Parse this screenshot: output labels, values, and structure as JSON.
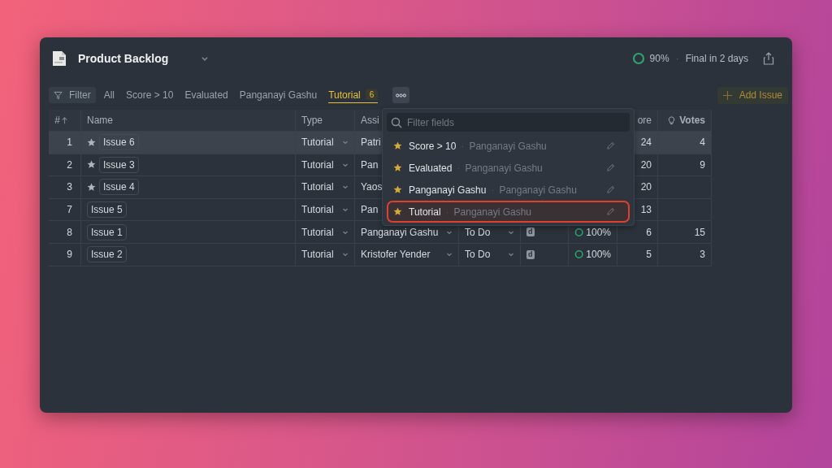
{
  "window": {
    "title": "Product Backlog",
    "progress": "90%",
    "separator": "·",
    "deadline": "Final in 2 days"
  },
  "toolbar": {
    "filter": "Filter",
    "tabs": [
      {
        "label": "All",
        "selected": false
      },
      {
        "label": "Score > 10",
        "selected": false
      },
      {
        "label": "Evaluated",
        "selected": false
      },
      {
        "label": "Panganayi Gashu",
        "selected": false
      },
      {
        "label": "Tutorial",
        "selected": true,
        "count": "6"
      }
    ],
    "add_button": "Add Issue"
  },
  "table": {
    "columns": [
      "#",
      "Name",
      "Type",
      "Assi",
      "",
      "",
      "",
      "ore",
      "Votes"
    ],
    "rows": [
      {
        "number": "1",
        "name": "Issue 6",
        "starred": true,
        "selected": true,
        "type": "Tutorial",
        "assignee": "Patri",
        "score": "24",
        "votes": "4"
      },
      {
        "number": "2",
        "name": "Issue 3",
        "starred": true,
        "selected": false,
        "type": "Tutorial",
        "assignee": "Pan",
        "score": "20",
        "votes": "9"
      },
      {
        "number": "3",
        "name": "Issue 4",
        "starred": true,
        "selected": false,
        "type": "Tutorial",
        "assignee": "Yaos",
        "score": "20"
      },
      {
        "number": "7",
        "name": "Issue 5",
        "starred": false,
        "selected": false,
        "type": "Tutorial",
        "assignee": "Pan",
        "score": "13"
      },
      {
        "number": "8",
        "name": "Issue 1",
        "starred": false,
        "selected": false,
        "type": "Tutorial",
        "assignee": "Panganayi Gashu",
        "assignee_menu": true,
        "status": "To Do",
        "badge": "d",
        "progress": "100%",
        "score": "6",
        "votes": "15"
      },
      {
        "number": "9",
        "name": "Issue 2",
        "starred": false,
        "selected": false,
        "type": "Tutorial",
        "assignee": "Kristofer Yender",
        "assignee_menu": true,
        "status": "To Do",
        "badge": "d",
        "progress": "100%",
        "score": "5",
        "votes": "3"
      }
    ]
  },
  "views_menu": {
    "placeholder": "Filter fields",
    "separator": "·",
    "items": [
      {
        "name": "Score > 10",
        "owner": "Panganayi Gashu",
        "selected": false
      },
      {
        "name": "Evaluated",
        "owner": "Panganayi Gashu",
        "selected": false
      },
      {
        "name": "Panganayi Gashu",
        "owner": "Panganayi Gashu",
        "selected": false
      },
      {
        "name": "Tutorial",
        "owner": "Panganayi Gashu",
        "selected": true
      }
    ]
  }
}
